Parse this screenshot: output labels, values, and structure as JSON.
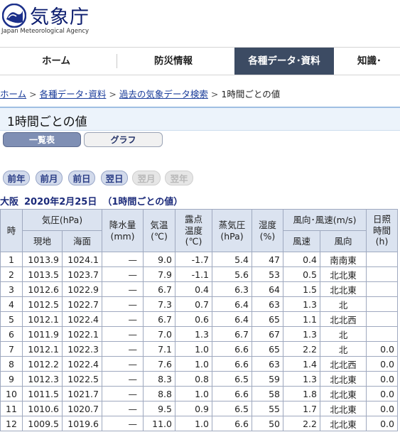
{
  "header": {
    "logo_title": "気象庁",
    "logo_subtitle": "Japan Meteorological Agency"
  },
  "nav": {
    "items": [
      {
        "label": "ホーム"
      },
      {
        "label": "防災情報"
      },
      {
        "label": "各種データ･資料",
        "active": true
      },
      {
        "label": "知識･"
      }
    ]
  },
  "breadcrumb": {
    "items": [
      "ホーム",
      "各種データ･資料",
      "過去の気象データ検索"
    ],
    "current": "1時間ごとの値"
  },
  "page_title": "1時間ごとの値",
  "view_tabs": {
    "list_label": "一覧表",
    "graph_label": "グラフ"
  },
  "date_nav": {
    "prev_year": "前年",
    "prev_month": "前月",
    "prev_day": "前日",
    "next_day": "翌日",
    "next_month": "翌月",
    "next_year": "翌年"
  },
  "caption": {
    "location": "大阪",
    "date": "2020年2月25日",
    "note": "（1時間ごとの値）"
  },
  "table": {
    "headers": {
      "hour": "時",
      "pressure": "気圧(hPa)",
      "pressure_station": "現地",
      "pressure_sea": "海面",
      "precip": "降水量\n(mm)",
      "temp": "気温\n(℃)",
      "dewpoint": "露点\n温度\n(℃)",
      "vapor": "蒸気圧\n(hPa)",
      "humidity": "湿度\n(%)",
      "wind": "風向･風速(m/s)",
      "wind_speed": "風速",
      "wind_dir": "風向",
      "sunshine": "日照\n時間\n(h)"
    },
    "rows": [
      {
        "hour": "1",
        "station": "1013.9",
        "sea": "1024.1",
        "precip": "—",
        "temp": "9.0",
        "dew": "-1.7",
        "vapor": "5.4",
        "hum": "47",
        "wspd": "0.4",
        "wdir": "南南東",
        "sun": ""
      },
      {
        "hour": "2",
        "station": "1013.5",
        "sea": "1023.7",
        "precip": "—",
        "temp": "7.9",
        "dew": "-1.1",
        "vapor": "5.6",
        "hum": "53",
        "wspd": "0.5",
        "wdir": "北北東",
        "sun": ""
      },
      {
        "hour": "3",
        "station": "1012.6",
        "sea": "1022.9",
        "precip": "—",
        "temp": "6.7",
        "dew": "0.4",
        "vapor": "6.3",
        "hum": "64",
        "wspd": "1.5",
        "wdir": "北北東",
        "sun": ""
      },
      {
        "hour": "4",
        "station": "1012.5",
        "sea": "1022.7",
        "precip": "—",
        "temp": "7.3",
        "dew": "0.7",
        "vapor": "6.4",
        "hum": "63",
        "wspd": "1.3",
        "wdir": "北",
        "sun": ""
      },
      {
        "hour": "5",
        "station": "1012.1",
        "sea": "1022.4",
        "precip": "—",
        "temp": "6.7",
        "dew": "0.6",
        "vapor": "6.4",
        "hum": "65",
        "wspd": "1.1",
        "wdir": "北北西",
        "sun": ""
      },
      {
        "hour": "6",
        "station": "1011.9",
        "sea": "1022.1",
        "precip": "—",
        "temp": "7.0",
        "dew": "1.3",
        "vapor": "6.7",
        "hum": "67",
        "wspd": "1.3",
        "wdir": "北",
        "sun": ""
      },
      {
        "hour": "7",
        "station": "1012.1",
        "sea": "1022.3",
        "precip": "—",
        "temp": "7.1",
        "dew": "1.0",
        "vapor": "6.6",
        "hum": "65",
        "wspd": "2.2",
        "wdir": "北",
        "sun": "0.0"
      },
      {
        "hour": "8",
        "station": "1012.2",
        "sea": "1022.4",
        "precip": "—",
        "temp": "7.6",
        "dew": "1.0",
        "vapor": "6.6",
        "hum": "63",
        "wspd": "1.4",
        "wdir": "北北西",
        "sun": "0.0"
      },
      {
        "hour": "9",
        "station": "1012.3",
        "sea": "1022.5",
        "precip": "—",
        "temp": "8.3",
        "dew": "0.8",
        "vapor": "6.5",
        "hum": "59",
        "wspd": "1.3",
        "wdir": "北北東",
        "sun": "0.0"
      },
      {
        "hour": "10",
        "station": "1011.5",
        "sea": "1021.7",
        "precip": "—",
        "temp": "8.8",
        "dew": "1.0",
        "vapor": "6.6",
        "hum": "58",
        "wspd": "1.8",
        "wdir": "北北東",
        "sun": "0.0"
      },
      {
        "hour": "11",
        "station": "1010.6",
        "sea": "1020.7",
        "precip": "—",
        "temp": "9.5",
        "dew": "0.9",
        "vapor": "6.5",
        "hum": "55",
        "wspd": "1.7",
        "wdir": "北北東",
        "sun": "0.0"
      },
      {
        "hour": "12",
        "station": "1009.5",
        "sea": "1019.6",
        "precip": "—",
        "temp": "11.0",
        "dew": "1.0",
        "vapor": "6.6",
        "hum": "50",
        "wspd": "2.2",
        "wdir": "北北東",
        "sun": "0.0"
      }
    ]
  }
}
